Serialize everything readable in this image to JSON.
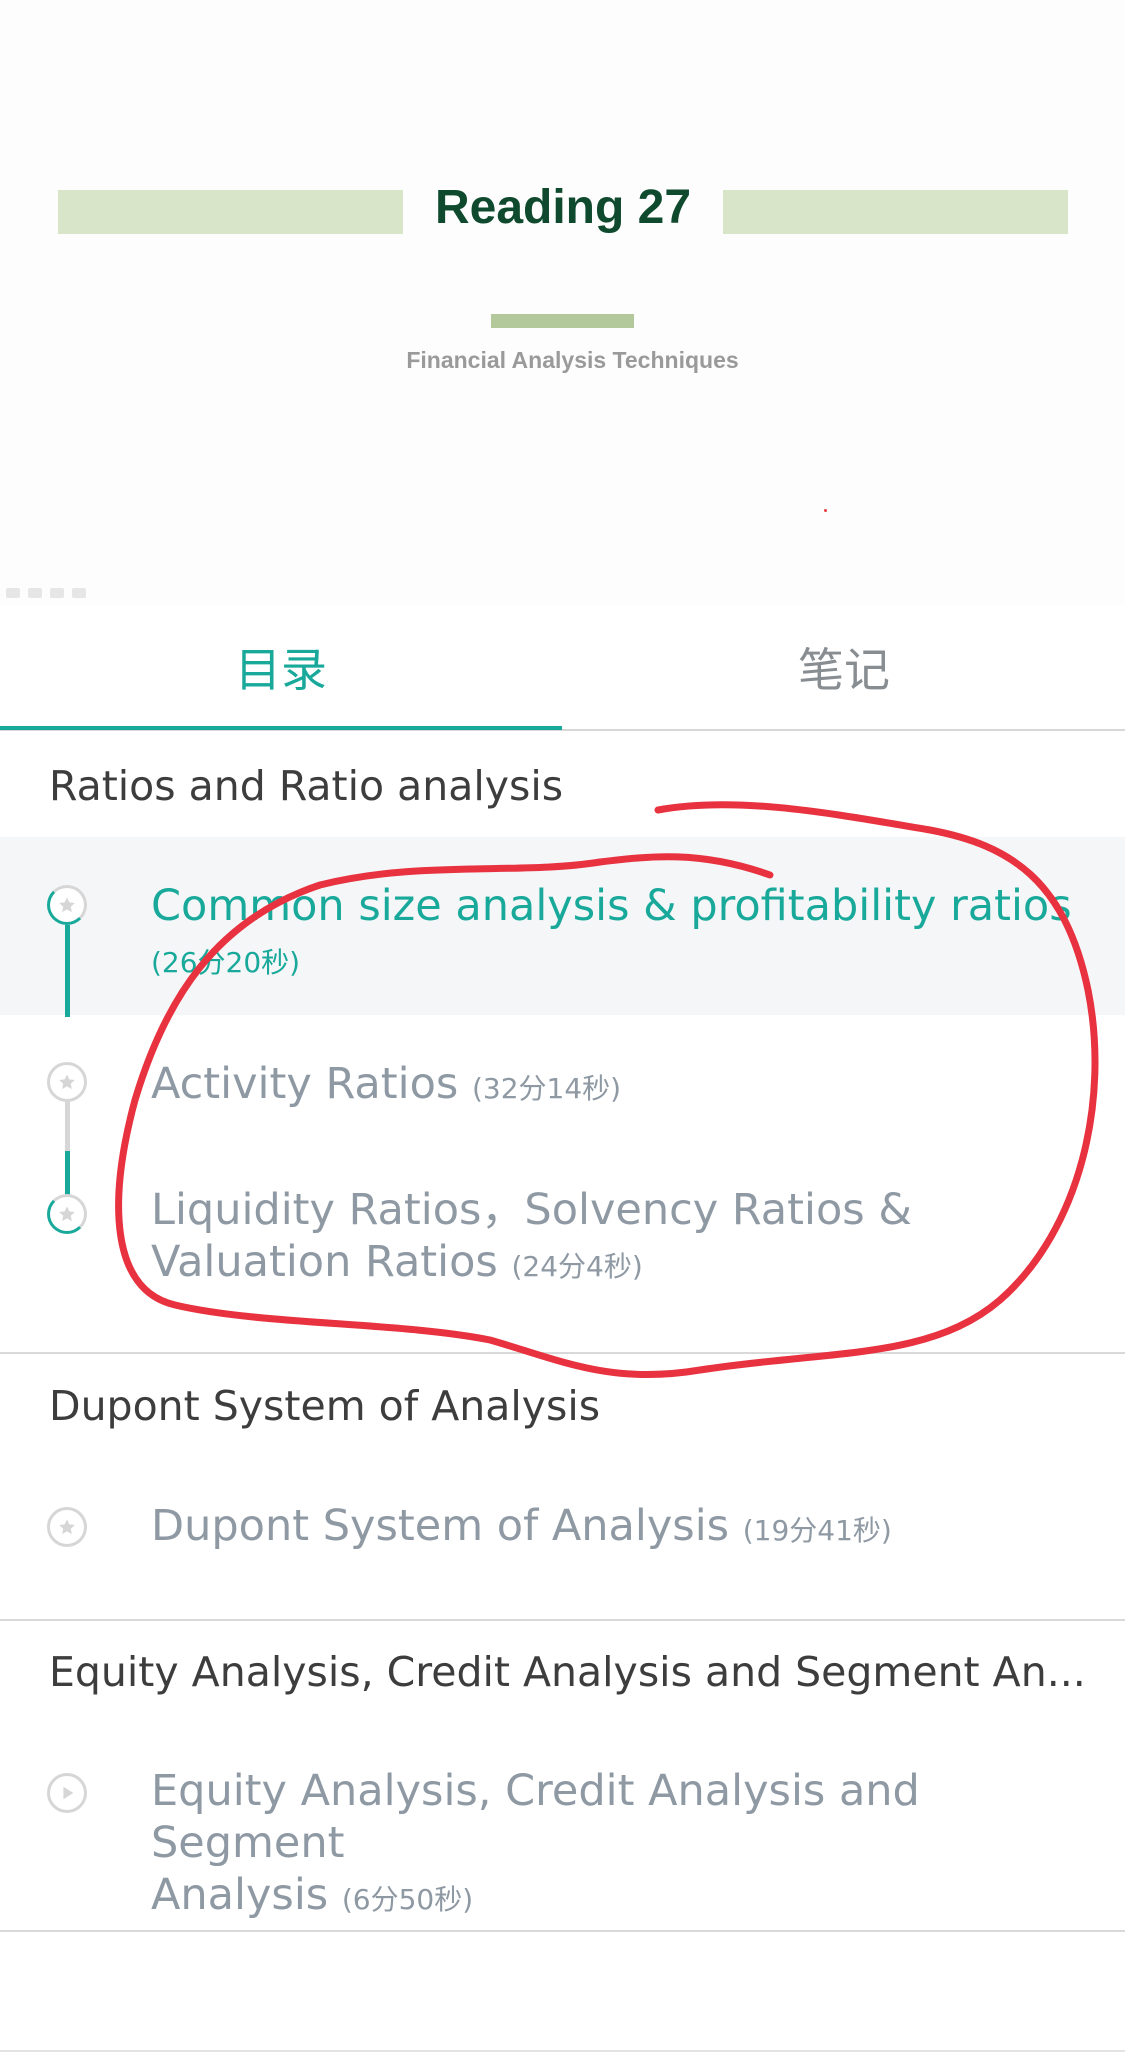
{
  "slide": {
    "title": "Reading 27",
    "subtitle": "Financial Analysis Techniques"
  },
  "tabs": {
    "catalog": "目录",
    "notes": "笔记"
  },
  "sections": [
    {
      "title": "Ratios and Ratio analysis",
      "items": [
        {
          "title": "Common size analysis & profitability ratios",
          "duration": "(26分20秒)",
          "state": "playing"
        },
        {
          "title": "Activity Ratios",
          "duration": "(32分14秒)",
          "state": "star"
        },
        {
          "title_line1": "Liquidity Ratios，Solvency Ratios &",
          "title_line2": "Valuation Ratios",
          "duration": "(24分4秒)",
          "state": "partial"
        }
      ]
    },
    {
      "title": "Dupont System of Analysis",
      "items": [
        {
          "title": "Dupont System of Analysis",
          "duration": "(19分41秒)",
          "state": "star"
        }
      ]
    },
    {
      "title": "Equity Analysis, Credit Analysis and Segment An...",
      "items": [
        {
          "title_line1": "Equity Analysis, Credit Analysis and Segment",
          "title_line2": "Analysis",
          "duration": "(6分50秒)",
          "state": "play"
        }
      ]
    }
  ],
  "colors": {
    "accent": "#19a99a",
    "item_text": "#8e99a3",
    "slide_title": "#0f4a2e",
    "slide_bar": "#d9e5c8",
    "annotation": "#e8323f"
  },
  "icons": [
    "star-icon",
    "play-icon"
  ]
}
